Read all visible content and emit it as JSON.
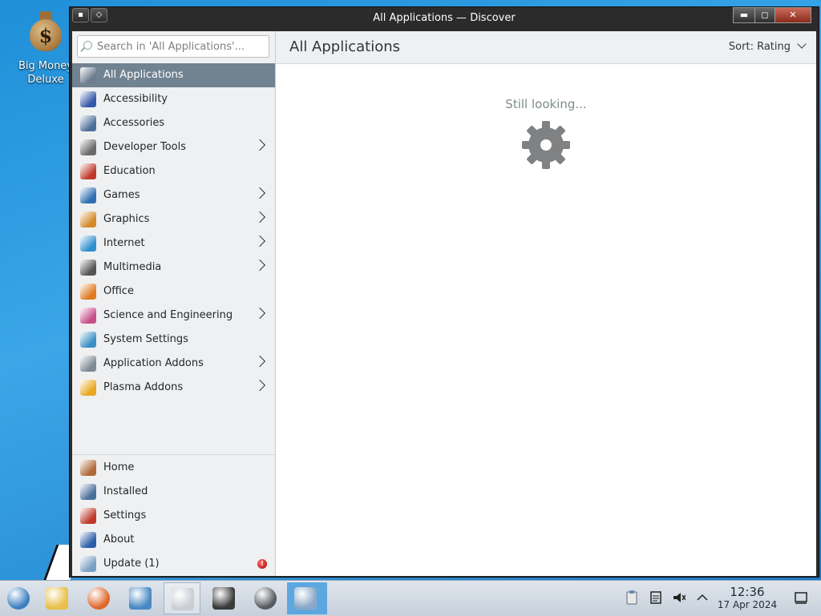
{
  "desktop": {
    "icon_label_line1": "Big Money",
    "icon_label_line2": "Deluxe"
  },
  "window": {
    "title": "All Applications — Discover",
    "controls": {
      "minimize": "▬",
      "maximize": "◻",
      "close": "✕"
    }
  },
  "search": {
    "placeholder": "Search in 'All Applications'..."
  },
  "sidebar": {
    "categories": [
      {
        "label": "All Applications",
        "icon": "grid-apps-icon",
        "color": "#6b7d8f",
        "has_children": false,
        "active": true
      },
      {
        "label": "Accessibility",
        "icon": "accessibility-icon",
        "color": "#3558a8",
        "has_children": false
      },
      {
        "label": "Accessories",
        "icon": "accessories-icon",
        "color": "#4a6f9a",
        "has_children": false
      },
      {
        "label": "Developer Tools",
        "icon": "developer-tools-icon",
        "color": "#6a6a6a",
        "has_children": true
      },
      {
        "label": "Education",
        "icon": "education-icon",
        "color": "#c0392b",
        "has_children": false
      },
      {
        "label": "Games",
        "icon": "games-icon",
        "color": "#2d6fb0",
        "has_children": true
      },
      {
        "label": "Graphics",
        "icon": "graphics-icon",
        "color": "#d68a2a",
        "has_children": true
      },
      {
        "label": "Internet",
        "icon": "internet-icon",
        "color": "#2f8fcf",
        "has_children": true
      },
      {
        "label": "Multimedia",
        "icon": "multimedia-icon",
        "color": "#555555",
        "has_children": true
      },
      {
        "label": "Office",
        "icon": "office-icon",
        "color": "#e07b22",
        "has_children": false
      },
      {
        "label": "Science and Engineering",
        "icon": "science-icon",
        "color": "#c84f8a",
        "has_children": true
      },
      {
        "label": "System Settings",
        "icon": "system-settings-icon",
        "color": "#3b8fc4",
        "has_children": false
      },
      {
        "label": "Application Addons",
        "icon": "application-addons-icon",
        "color": "#7d8a96",
        "has_children": true
      },
      {
        "label": "Plasma Addons",
        "icon": "plasma-addons-icon",
        "color": "#e8a820",
        "has_children": true
      }
    ],
    "bottom": [
      {
        "label": "Home",
        "icon": "home-icon",
        "color": "#b06a3a"
      },
      {
        "label": "Installed",
        "icon": "installed-icon",
        "color": "#4a6f9a"
      },
      {
        "label": "Settings",
        "icon": "settings-icon",
        "color": "#c0392b"
      },
      {
        "label": "About",
        "icon": "about-icon",
        "color": "#2c5fa8"
      },
      {
        "label": "Update (1)",
        "icon": "update-icon",
        "color": "#7aa0c4",
        "badge": "!"
      }
    ]
  },
  "main": {
    "title": "All Applications",
    "sort_label": "Sort: Rating",
    "loading_text": "Still looking..."
  },
  "taskbar": {
    "items": [
      "start-orb-icon",
      "file-manager-icon",
      "firefox-icon",
      "control-panel-icon",
      "x-app-icon",
      "window-switcher-icon",
      "safari-compass-icon",
      "discover-icon"
    ],
    "clock_time": "12:36",
    "clock_date": "17 Apr 2024"
  }
}
